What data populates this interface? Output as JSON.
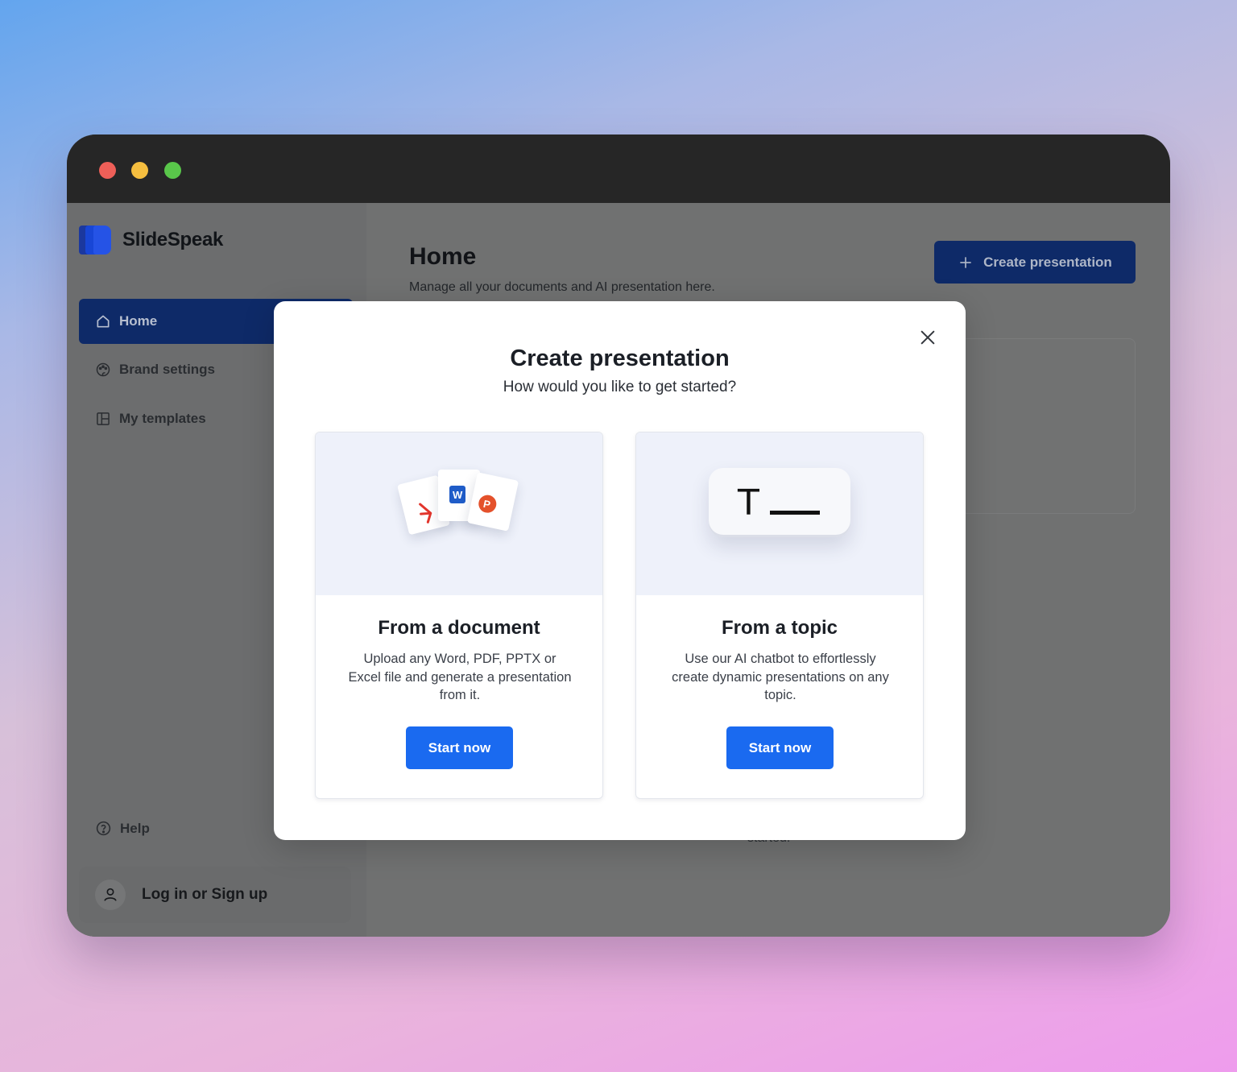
{
  "window": {
    "traffic_lights": [
      "close",
      "minimize",
      "maximize"
    ]
  },
  "brand": {
    "name": "SlideSpeak",
    "colors": [
      "#1846d6",
      "#2553e6",
      "#0d2fa8"
    ]
  },
  "sidebar": {
    "items": [
      {
        "label": "Home",
        "icon": "home-icon",
        "active": true
      },
      {
        "label": "Brand settings",
        "icon": "palette-icon",
        "active": false
      },
      {
        "label": "My templates",
        "icon": "templates-icon",
        "active": false
      }
    ],
    "help_label": "Help",
    "login_label": "Log in or Sign up"
  },
  "main": {
    "title": "Home",
    "subtitle": "Manage all your documents and AI presentation here.",
    "create_button_label": "Create presentation",
    "background_text": "started."
  },
  "modal": {
    "title": "Create presentation",
    "subtitle": "How would you like to get started?",
    "close_icon": "close-icon",
    "cards": [
      {
        "title": "From a document",
        "description": "Upload any Word, PDF, PPTX or Excel file and generate a presentation from it.",
        "button_label": "Start now",
        "art": "document-stack-icon"
      },
      {
        "title": "From a topic",
        "description": "Use our AI chatbot to effortlessly create dynamic presentations on any topic.",
        "button_label": "Start now",
        "art": "text-key-icon"
      }
    ],
    "accent_color": "#1a6af0"
  }
}
